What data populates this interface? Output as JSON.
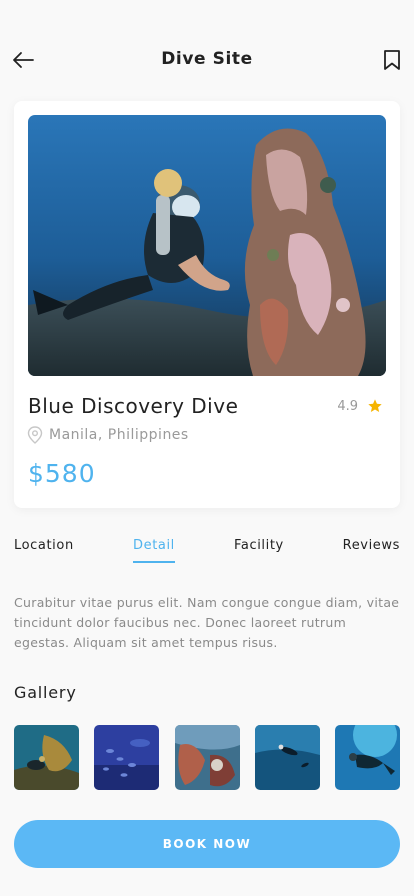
{
  "header": {
    "title": "Dive Site",
    "back_icon": "arrow-left-icon",
    "bookmark_icon": "bookmark-icon"
  },
  "site": {
    "name": "Blue Discovery Dive",
    "rating": "4.9",
    "location": "Manila, Philippines",
    "price": "$580",
    "hero_image": "diver-near-coral-statue"
  },
  "tabs": [
    {
      "label": "Location",
      "active": false
    },
    {
      "label": "Detail",
      "active": true
    },
    {
      "label": "Facility",
      "active": false
    },
    {
      "label": "Reviews",
      "active": false
    }
  ],
  "description": "Curabitur vitae purus elit. Nam congue congue diam, vitae tincidunt dolor faucibus nec. Donec laoreet rutrum egestas. Aliquam sit amet tempus risus.",
  "gallery": {
    "title": "Gallery",
    "items": [
      {
        "subject": "diver-exploring-wreck"
      },
      {
        "subject": "school-of-fish"
      },
      {
        "subject": "diver-with-coral"
      },
      {
        "subject": "divers-deep-blue"
      },
      {
        "subject": "diver-sunlit-water"
      }
    ]
  },
  "cta": {
    "label": "BOOK NOW"
  },
  "colors": {
    "accent": "#4fb3ee",
    "button": "#5bb8f5",
    "star": "#f5b400",
    "background": "#f9f9f9"
  }
}
